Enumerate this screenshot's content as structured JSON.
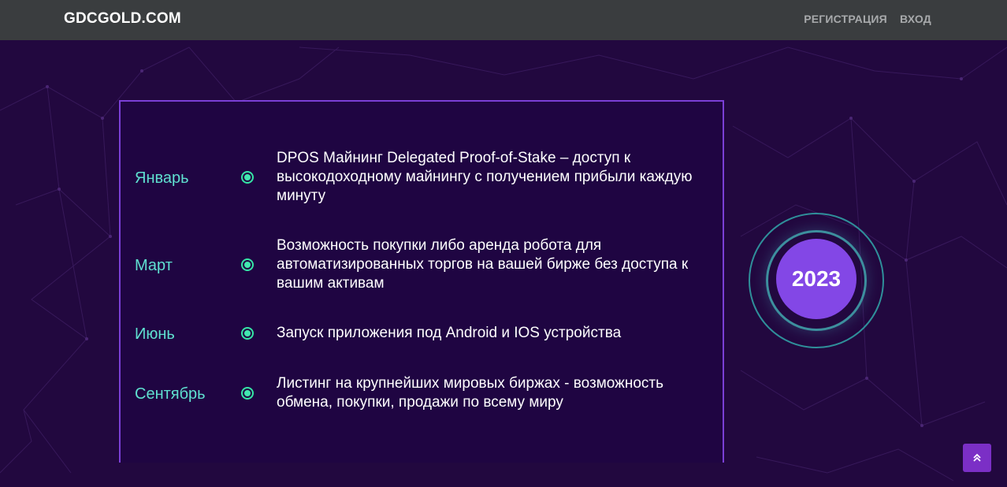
{
  "navbar": {
    "brand": "GDCGOLD.COM",
    "links": [
      "РЕГИСТРАЦИЯ",
      "ВХОД"
    ]
  },
  "roadmap": {
    "year": "2023",
    "items": [
      {
        "month": "Январь",
        "text": "DPOS Майнинг Delegated Proof-of-Stake – доступ к высокодоходному майнингу с получением прибыли каждую минуту"
      },
      {
        "month": "Март",
        "text": "Возможность покупки либо аренда робота для автоматизированных торгов на вашей бирже без доступа к вашим активам"
      },
      {
        "month": "Июнь",
        "text": "Запуск приложения под Android и IOS устройства"
      },
      {
        "month": "Сентябрь",
        "text": "Листинг на крупнейших мировых биржах - возможность обмена, покупки, продажи по всему миру"
      }
    ]
  },
  "scroll_top": {
    "icon": "double-chevron-up-icon"
  },
  "colors": {
    "background": "#22083f",
    "navbar": "#3a3d3f",
    "card_border": "#7b3fd6",
    "month": "#5fe0d0",
    "dot": "#42e8b0",
    "year_core": "#8347e6",
    "scroll_button": "#7b2fc6"
  }
}
